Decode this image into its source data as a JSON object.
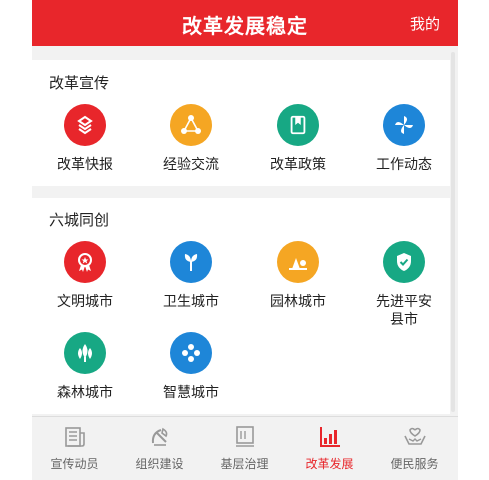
{
  "header": {
    "title": "改革发展稳定",
    "right_link": "我的"
  },
  "section_reform": {
    "title": "改革宣传",
    "items": [
      {
        "label": "改革快报",
        "color": "#e8262b",
        "icon": "stacked-layers-icon"
      },
      {
        "label": "经验交流",
        "color": "#f5a623",
        "icon": "share-network-icon"
      },
      {
        "label": "改革政策",
        "color": "#17a884",
        "icon": "bookmark-document-icon"
      },
      {
        "label": "工作动态",
        "color": "#1e86d8",
        "icon": "pinwheel-icon"
      }
    ]
  },
  "section_city": {
    "title": "六城同创",
    "items": [
      {
        "label": "文明城市",
        "color": "#e8262b",
        "icon": "medal-star-icon"
      },
      {
        "label": "卫生城市",
        "color": "#1e86d8",
        "icon": "leaf-sprout-icon"
      },
      {
        "label": "园林城市",
        "color": "#f5a623",
        "icon": "landscape-icon"
      },
      {
        "label": "先进平安县市",
        "label_line1": "先进平安",
        "label_line2": "县市",
        "color": "#17a884",
        "icon": "shield-check-icon"
      },
      {
        "label": "森林城市",
        "color": "#17a884",
        "icon": "forest-trees-icon"
      },
      {
        "label": "智慧城市",
        "color": "#1e86d8",
        "icon": "network-nodes-icon"
      }
    ]
  },
  "tabbar": {
    "active_color": "#e8262b",
    "tabs": [
      {
        "label": "宣传动员",
        "icon": "newspaper-icon",
        "active": false
      },
      {
        "label": "组织建设",
        "icon": "party-emblem-icon",
        "active": false
      },
      {
        "label": "基层治理",
        "icon": "document-list-icon",
        "active": false
      },
      {
        "label": "改革发展",
        "icon": "bar-chart-icon",
        "active": true
      },
      {
        "label": "便民服务",
        "icon": "helping-hands-icon",
        "active": false
      }
    ]
  }
}
